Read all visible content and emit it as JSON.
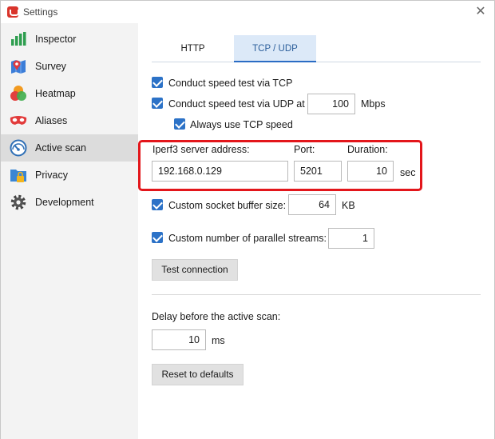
{
  "window": {
    "title": "Settings",
    "close_glyph": "✕"
  },
  "sidebar": {
    "items": [
      {
        "label": "Inspector",
        "icon": "bar-chart-icon"
      },
      {
        "label": "Survey",
        "icon": "map-pin-icon"
      },
      {
        "label": "Heatmap",
        "icon": "heatmap-icon"
      },
      {
        "label": "Aliases",
        "icon": "mask-icon"
      },
      {
        "label": "Active scan",
        "icon": "gauge-icon",
        "active": true
      },
      {
        "label": "Privacy",
        "icon": "lock-folder-icon"
      },
      {
        "label": "Development",
        "icon": "gear-icon"
      }
    ]
  },
  "tabs": [
    {
      "label": "HTTP",
      "selected": false
    },
    {
      "label": "TCP / UDP",
      "selected": true
    }
  ],
  "options": {
    "tcp_label": "Conduct speed test via TCP",
    "udp_label": "Conduct speed test via UDP at",
    "udp_value": "100",
    "udp_unit": "Mbps",
    "always_tcp_label": "Always use TCP speed"
  },
  "server": {
    "address_label": "Iperf3 server address:",
    "address_value": "192.168.0.129",
    "port_label": "Port:",
    "port_value": "5201",
    "duration_label": "Duration:",
    "duration_value": "10",
    "duration_unit": "sec"
  },
  "buffer": {
    "label": "Custom socket buffer size:",
    "value": "64",
    "unit": "KB"
  },
  "streams": {
    "label": "Custom number of parallel streams:",
    "value": "1"
  },
  "test_button": "Test connection",
  "delay": {
    "label": "Delay before the active scan:",
    "value": "10",
    "unit": "ms"
  },
  "reset_button": "Reset to defaults",
  "colors": {
    "accent": "#2c72c7",
    "highlight": "#e3161b",
    "tab_selected_bg": "#dce9f8"
  }
}
